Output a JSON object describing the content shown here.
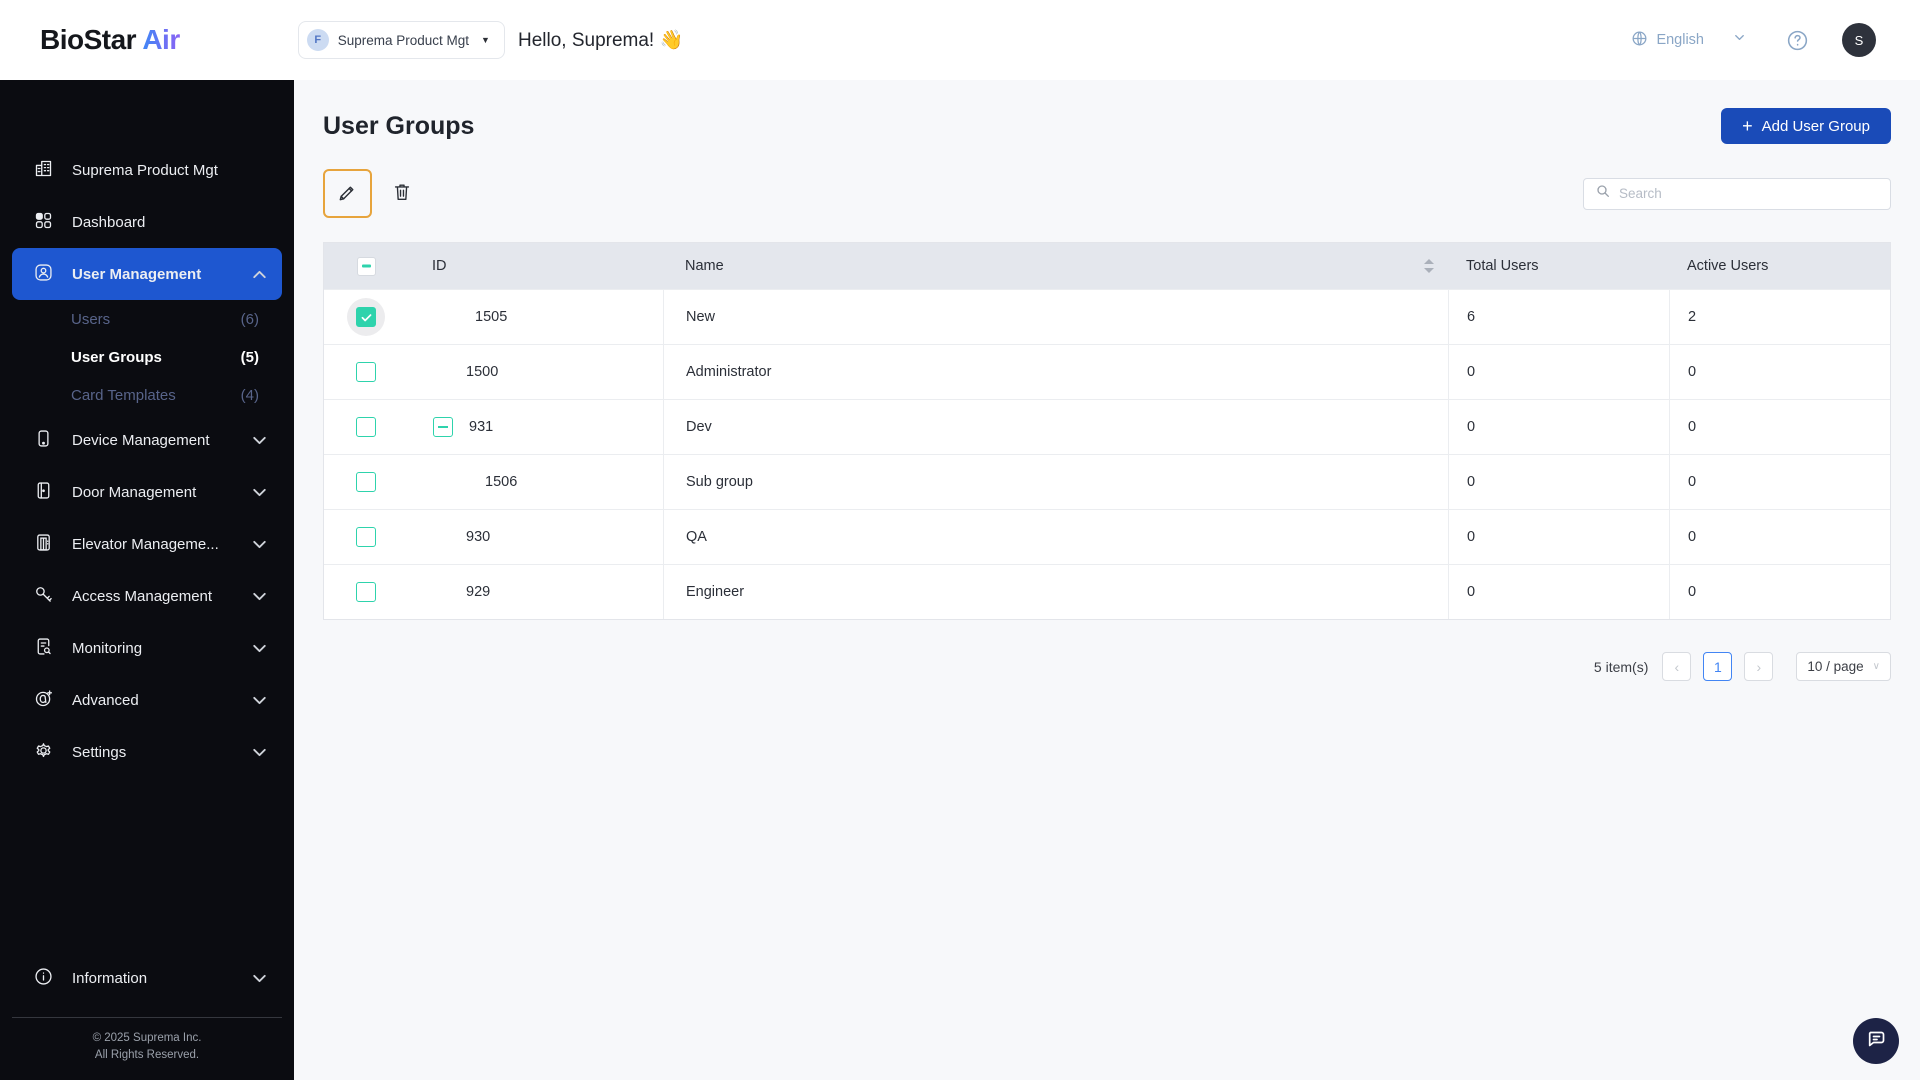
{
  "header": {
    "logo_primary": "BioStar",
    "logo_accent": "Air",
    "workspace": {
      "badge": "F",
      "name": "Suprema Product Mgt"
    },
    "greeting": "Hello, Suprema! 👋",
    "language": "English",
    "avatar_initial": "S"
  },
  "sidebar": {
    "items": [
      {
        "label": "Suprema Product Mgt",
        "icon": "building-icon"
      },
      {
        "label": "Dashboard",
        "icon": "dashboard-icon"
      },
      {
        "label": "User Management",
        "icon": "user-icon",
        "active": true,
        "chevron": "up"
      },
      {
        "label": "Users",
        "count": "(6)",
        "type": "sub"
      },
      {
        "label": "User Groups",
        "count": "(5)",
        "type": "sub",
        "active": true
      },
      {
        "label": "Card Templates",
        "count": "(4)",
        "type": "sub"
      },
      {
        "label": "Device Management",
        "icon": "device-icon",
        "chevron": "down"
      },
      {
        "label": "Door Management",
        "icon": "door-icon",
        "chevron": "down"
      },
      {
        "label": "Elevator Manageme...",
        "icon": "elevator-icon",
        "chevron": "down"
      },
      {
        "label": "Access Management",
        "icon": "key-icon",
        "chevron": "down"
      },
      {
        "label": "Monitoring",
        "icon": "monitoring-icon",
        "chevron": "down"
      },
      {
        "label": "Advanced",
        "icon": "advanced-icon",
        "chevron": "down"
      },
      {
        "label": "Settings",
        "icon": "gear-icon",
        "chevron": "down"
      }
    ],
    "information": {
      "label": "Information",
      "icon": "info-icon",
      "chevron": "down"
    },
    "copyright_line1": "© 2025 Suprema Inc.",
    "copyright_line2": "All Rights Reserved."
  },
  "main": {
    "title": "User Groups",
    "add_button_plus": "+",
    "add_button_label": "Add User Group",
    "search_placeholder": "Search",
    "table": {
      "columns": {
        "id": "ID",
        "name": "Name",
        "total": "Total Users",
        "active": "Active Users"
      },
      "rows": [
        {
          "id": "1505",
          "name": "New",
          "total": "6",
          "active": "2",
          "checked": true
        },
        {
          "id": "1500",
          "name": "Administrator",
          "total": "0",
          "active": "0",
          "checked": false
        },
        {
          "id": "931",
          "name": "Dev",
          "total": "0",
          "active": "0",
          "checked": false,
          "expander": true,
          "expanded": true
        },
        {
          "id": "1506",
          "name": "Sub group",
          "total": "0",
          "active": "0",
          "checked": false,
          "child": true
        },
        {
          "id": "930",
          "name": "QA",
          "total": "0",
          "active": "0",
          "checked": false
        },
        {
          "id": "929",
          "name": "Engineer",
          "total": "0",
          "active": "0",
          "checked": false
        }
      ]
    },
    "pagination": {
      "count": "5 item(s)",
      "prev": "‹",
      "page": "1",
      "next": "›",
      "page_size": "10 / page"
    }
  },
  "colors": {
    "sidebar_bg": "#0b0c11",
    "active_nav_blue": "#1e57d0",
    "primary_button_blue": "#1a4bb8",
    "teal_checkbox": "#2ed3ac",
    "edit_highlight_amber": "#e7a43c",
    "table_header_bg": "#e4e7ed",
    "pagination_active_blue": "#4285f4",
    "fab_navy": "#1d2346",
    "header_icon_blue_gray": "#8aa6c6"
  }
}
